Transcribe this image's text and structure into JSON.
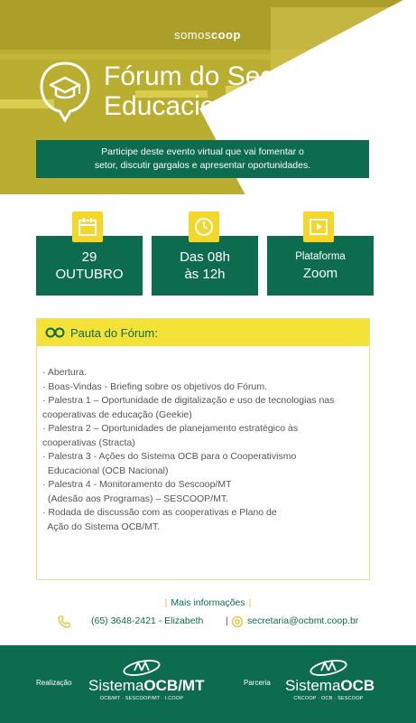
{
  "brand": {
    "somos_prefix": "somos",
    "somos_suffix": "coop"
  },
  "event": {
    "title_line1": "Fórum do Segmento",
    "title_line2": "Educacional",
    "subtitle_line1": "Participe deste evento virtual que vai fomentar o",
    "subtitle_line2": "setor, discutir gargalos e apresentar oportunidades."
  },
  "cards": {
    "date": {
      "icon": "calendar-icon",
      "line1": "29",
      "line2": "OUTUBRO"
    },
    "time": {
      "icon": "clock-icon",
      "line1": "Das 08h",
      "line2": "às 12h"
    },
    "platform": {
      "icon": "play-icon",
      "line1": "Plataforma",
      "line2": "Zoom"
    }
  },
  "agenda": {
    "heading": "Pauta do Fórum:",
    "items": [
      "· Abertura.",
      "· Boas-Vindas - Briefing sobre os objetivos do Fórum.",
      "· Palestra 1 – Oportunidade de digitalização e uso de tecnologias nas",
      "cooperativas de educação (Geekie)",
      "· Palestra 2 – Oportunidades de planejamento estratégico às",
      "cooperativas (Stracta)",
      "· Palestra 3 - Ações do Sistema OCB para o Cooperativismo",
      "  Educacional (OCB Nacional)",
      "· Palestra 4 - Monitoramento do Sescoop/MT",
      "  (Adesão aos Programas) – SESCOOP/MT.",
      "· Rodada de discussão com as cooperativas e Plano de",
      "  Ação do Sistema OCB/MT."
    ]
  },
  "contact": {
    "more_info": "Mais informações",
    "separator": "|",
    "phone": "(65) 3648-2421 - Elizabeth",
    "email": "secretaria@ocbmt.coop.br"
  },
  "footer": {
    "realizacao_label": "Realização",
    "parceria_label": "Parceria",
    "logo1_name_prefix": "Sistema",
    "logo1_name_bold": "OCB/MT",
    "logo1_sub": "OCB/MT · SESCOOP/MT · I.COOP",
    "logo2_name_prefix": "Sistema",
    "logo2_name_bold": "OCB",
    "logo2_sub": "CNCOOP · OCB · SESCOOP"
  },
  "colors": {
    "green": "#0d6b4e",
    "yellow": "#f5d72a",
    "text_gray": "#555555"
  }
}
